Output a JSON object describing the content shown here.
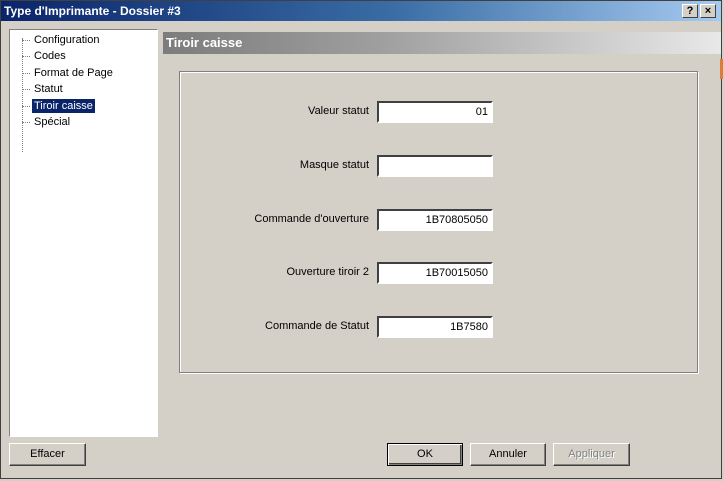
{
  "window": {
    "title": "Type d'Imprimante - Dossier #3",
    "help_label": "?",
    "close_label": "×"
  },
  "tree": {
    "items": [
      {
        "label": "Configuration",
        "selected": false
      },
      {
        "label": "Codes",
        "selected": false
      },
      {
        "label": "Format de Page",
        "selected": false
      },
      {
        "label": "Statut",
        "selected": false
      },
      {
        "label": "Tiroir caisse",
        "selected": true
      },
      {
        "label": "Spécial",
        "selected": false
      }
    ]
  },
  "panel": {
    "title": "Tiroir caisse",
    "fields": [
      {
        "label": "Valeur statut",
        "value": "01"
      },
      {
        "label": "Masque statut",
        "value": ""
      },
      {
        "label": "Commande d'ouverture",
        "value": "1B70805050"
      },
      {
        "label": "Ouverture tiroir 2",
        "value": "1B70015050"
      },
      {
        "label": "Commande de Statut",
        "value": "1B7580"
      }
    ]
  },
  "buttons": {
    "clear": "Effacer",
    "ok": "OK",
    "cancel": "Annuler",
    "apply": "Appliquer"
  }
}
